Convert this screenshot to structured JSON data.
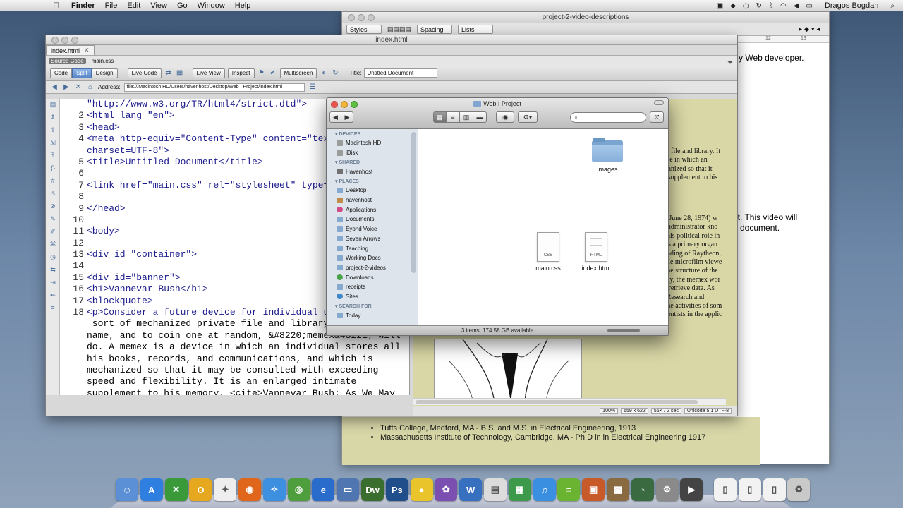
{
  "menubar": {
    "app": "Finder",
    "items": [
      "File",
      "Edit",
      "View",
      "Go",
      "Window",
      "Help"
    ],
    "user": "Dragos Bogdan"
  },
  "textedit": {
    "title": "project-2-video-descriptions",
    "toolbar": {
      "styles": "Styles",
      "spacing": "Spacing",
      "lists": "Lists"
    },
    "ruler_marks": [
      "12",
      "13"
    ],
    "visible_text": {
      "web_dev": "y Web developer.",
      "video_will": "nt. This video will",
      "document": "document."
    },
    "education": [
      "Tufts College, Medford, MA - B.S. and M.S. in Electrical Engineering, 1913",
      "Massachusetts Institute of Technology, Cambridge, MA - Ph.D in in Electrical Engineering 1917"
    ]
  },
  "dreamweaver": {
    "window_title": "index.html",
    "tab_label": "index.html",
    "related_file": "main.css",
    "source_code_label": "Source Code",
    "view_buttons": [
      "Code",
      "Split",
      "Design"
    ],
    "active_view": "Split",
    "live_code": "Live Code",
    "live_view": "Live View",
    "inspect": "Inspect",
    "multiscreen": "Multiscreen",
    "title_label": "Title:",
    "title_value": "Untitled Document",
    "address_label": "Address:",
    "address_value": "file:///Macintosh HD/Users/havenhost/Desktop/Web I Project/index.html",
    "line_numbers": [
      "",
      "2",
      "3",
      "4",
      "",
      "5",
      "6",
      "7",
      "8",
      "9",
      "10",
      "11",
      "12",
      "13",
      "14",
      "15",
      "16",
      "17",
      "18",
      "",
      "",
      "",
      "",
      "",
      ""
    ],
    "code_lines": [
      "\"http://www.w3.org/TR/html4/strict.dtd\">",
      "<html lang=\"en\">",
      "<head>",
      "<meta http-equiv=\"Content-Type\" content=\"text",
      "charset=UTF-8\">",
      "<title>Untitled Document</title>",
      "",
      "<link href=\"main.css\" rel=\"stylesheet\" type=\"",
      "",
      "</head>",
      "",
      "<body>",
      "",
      "<div id=\"container\">",
      "",
      "<div id=\"banner\">",
      "<h1>Vannevar Bush</h1>",
      "<blockquote>",
      "<p>Consider a future device for individual us",
      " sort of mechanized private file and library.",
      "name, and to coin one at random, &#8220;memex&#8221; will",
      "do. A memex is a device in which an individual stores all",
      "his books, records, and communications, and which is",
      "mechanized so that it may be consulted with exceeding",
      "speed and flexibility. It is an enlarged intimate",
      "supplement to his memory. <cite>Vannevar Bush: As We May"
    ],
    "design_text_1": [
      "ate file and library. It",
      "vice in which an",
      "chanized so that it",
      "te supplement to his"
    ],
    "design_text_2": [
      "0 - June 28, 1974) w",
      "ce administrator kno",
      "n, his political role in",
      "b as a primary organ",
      "ounding of Raytheon,",
      "table microfilm viewe",
      "o the structure of the",
      "cally, the memex wor",
      "nd retrieve data. As",
      "ic Research and",
      "d the activities of som",
      "scientists in the applic"
    ],
    "status": {
      "zoom": "100%",
      "size": "659 x 622",
      "download": "56K / 2 sec",
      "encoding": "Unicode 5.1 UTF-8"
    }
  },
  "finder": {
    "title": "Web I Project",
    "sections": [
      {
        "header": "DEVICES",
        "items": [
          {
            "label": "Macintosh HD",
            "icon": "disk"
          },
          {
            "label": "iDisk",
            "icon": "disk"
          }
        ]
      },
      {
        "header": "SHARED",
        "items": [
          {
            "label": "Havenhost",
            "icon": "net"
          }
        ]
      },
      {
        "header": "PLACES",
        "items": [
          {
            "label": "Desktop",
            "icon": "fold"
          },
          {
            "label": "havenhost",
            "icon": "home"
          },
          {
            "label": "Applications",
            "icon": "app"
          },
          {
            "label": "Documents",
            "icon": "fold"
          },
          {
            "label": "Eyond Voice",
            "icon": "fold"
          },
          {
            "label": "Seven Arrows",
            "icon": "fold"
          },
          {
            "label": "Teaching",
            "icon": "fold"
          },
          {
            "label": "Working Docs",
            "icon": "fold"
          },
          {
            "label": "project-2-videos",
            "icon": "fold"
          },
          {
            "label": "Downloads",
            "icon": "dl"
          },
          {
            "label": "receipts",
            "icon": "fold"
          },
          {
            "label": "Sites",
            "icon": "globe"
          }
        ]
      },
      {
        "header": "SEARCH FOR",
        "items": [
          {
            "label": "Today",
            "icon": "fold"
          }
        ]
      }
    ],
    "files": [
      {
        "name": "images",
        "kind": "folder"
      },
      {
        "name": "main.css",
        "kind": "file",
        "badge": "CSS"
      },
      {
        "name": "index.html",
        "kind": "file",
        "badge": "HTML"
      }
    ],
    "status": "3 items, 174.58 GB available"
  },
  "dock": {
    "apps": [
      {
        "name": "finder",
        "color": "#5b8fd6",
        "glyph": "☺"
      },
      {
        "name": "app-store",
        "color": "#2f7fe0",
        "glyph": "A"
      },
      {
        "name": "app-x",
        "color": "#3a9a3a",
        "glyph": "✕"
      },
      {
        "name": "app-o",
        "color": "#e6a81e",
        "glyph": "O"
      },
      {
        "name": "app-dance",
        "color": "#eeeeee",
        "glyph": "✦"
      },
      {
        "name": "firefox",
        "color": "#e0661c",
        "glyph": "◉"
      },
      {
        "name": "safari",
        "color": "#3d8fe0",
        "glyph": "✧"
      },
      {
        "name": "chrome",
        "color": "#4e9e3e",
        "glyph": "◎"
      },
      {
        "name": "ie",
        "color": "#2a6ccc",
        "glyph": "e"
      },
      {
        "name": "media",
        "color": "#5076b2",
        "glyph": "▭"
      },
      {
        "name": "dreamweaver",
        "color": "#3a6e2e",
        "glyph": "Dw"
      },
      {
        "name": "photoshop",
        "color": "#1f4e8a",
        "glyph": "Ps"
      },
      {
        "name": "duck",
        "color": "#e9c52b",
        "glyph": "●"
      },
      {
        "name": "app-purple",
        "color": "#7b4fb0",
        "glyph": "✿"
      },
      {
        "name": "app-w",
        "color": "#3870c0",
        "glyph": "W"
      },
      {
        "name": "preview",
        "color": "#dcdcdc",
        "glyph": "▤"
      },
      {
        "name": "numbers",
        "color": "#3d9a4a",
        "glyph": "▦"
      },
      {
        "name": "itunes",
        "color": "#3a8fe0",
        "glyph": "♫"
      },
      {
        "name": "spotify",
        "color": "#6bb431",
        "glyph": "≡"
      },
      {
        "name": "jar",
        "color": "#c85a2a",
        "glyph": "▣"
      },
      {
        "name": "photo",
        "color": "#8a6a40",
        "glyph": "▩"
      },
      {
        "name": "time-machine",
        "color": "#3a6a40",
        "glyph": "◔"
      },
      {
        "name": "system-prefs",
        "color": "#8a8a8a",
        "glyph": "⚙"
      },
      {
        "name": "app-film",
        "color": "#444",
        "glyph": "▶"
      },
      {
        "name": "doc-1",
        "color": "#f2f2f2",
        "glyph": "▯"
      },
      {
        "name": "doc-2",
        "color": "#f2f2f2",
        "glyph": "▯"
      },
      {
        "name": "doc-3",
        "color": "#f2f2f2",
        "glyph": "▯"
      },
      {
        "name": "trash",
        "color": "#c9c9c9",
        "glyph": "♻"
      }
    ]
  }
}
